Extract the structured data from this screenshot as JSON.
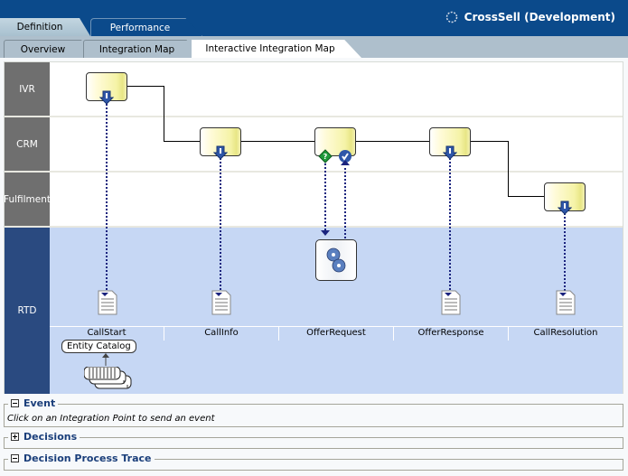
{
  "header": {
    "app_title": "CrossSell (Development)",
    "app_icon": "spinner-icon",
    "primary_tabs": [
      {
        "label": "Definition",
        "active": true
      },
      {
        "label": "Performance",
        "active": false
      }
    ],
    "secondary_tabs": [
      {
        "label": "Overview",
        "active": false
      },
      {
        "label": "Integration Map",
        "active": false
      },
      {
        "label": "Interactive Integration Map",
        "active": true
      }
    ]
  },
  "map": {
    "lanes": [
      {
        "label": "IVR"
      },
      {
        "label": "CRM"
      },
      {
        "label": "Fulfilment"
      },
      {
        "label": "RTD"
      }
    ],
    "integration_points": [
      {
        "label": "CallStart",
        "lane": "IVR",
        "type": "informant"
      },
      {
        "label": "CallInfo",
        "lane": "CRM",
        "type": "informant"
      },
      {
        "label": "OfferRequest",
        "lane": "CRM",
        "type": "advisor"
      },
      {
        "label": "OfferResponse",
        "lane": "CRM",
        "type": "informant"
      },
      {
        "label": "CallResolution",
        "lane": "Fulfilment",
        "type": "informant"
      }
    ],
    "entity_catalog_label": "Entity Catalog",
    "colors": {
      "lane_label_gray": "#6f6f6f",
      "rtd_label": "#2a4a80",
      "rtd_lane": "#c6d7f4",
      "header": "#0b4a8b"
    }
  },
  "panels": [
    {
      "title": "Event",
      "expanded": true,
      "body": "Click on an Integration Point to send an event"
    },
    {
      "title": "Decisions",
      "expanded": false,
      "body": ""
    },
    {
      "title": "Decision Process Trace",
      "expanded": true,
      "body": ""
    }
  ]
}
